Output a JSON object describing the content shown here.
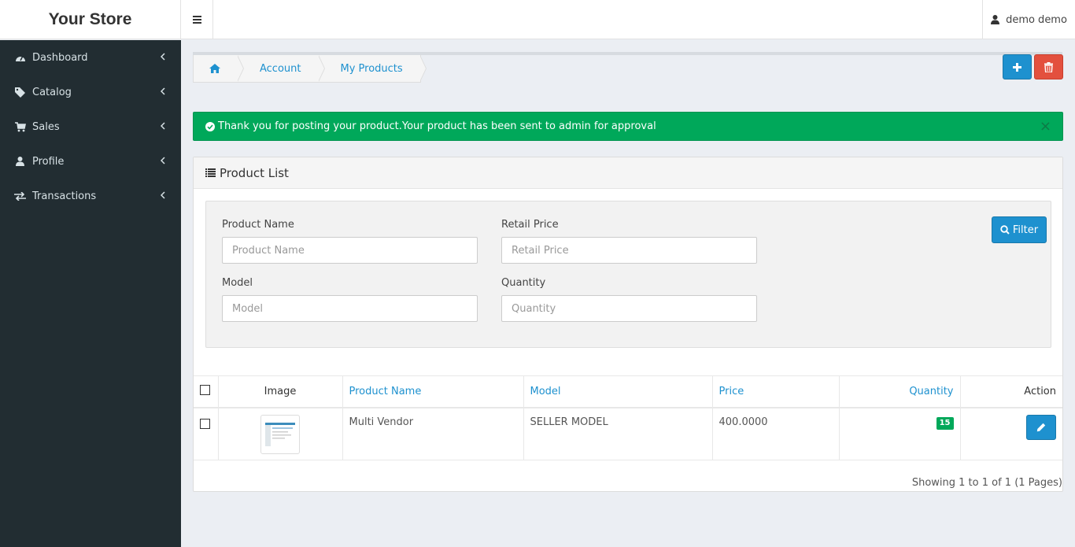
{
  "header": {
    "brand": "Your Store",
    "user": "demo demo"
  },
  "sidebar": {
    "items": [
      {
        "label": "Dashboard",
        "icon": "dashboard-icon"
      },
      {
        "label": "Catalog",
        "icon": "tag-icon"
      },
      {
        "label": "Sales",
        "icon": "cart-icon"
      },
      {
        "label": "Profile",
        "icon": "user-icon"
      },
      {
        "label": "Transactions",
        "icon": "exchange-icon"
      }
    ]
  },
  "breadcrumb": [
    "Account",
    "My Products"
  ],
  "alert": {
    "message": "Thank you for posting your product.Your product has been sent to admin for approval",
    "close": "×"
  },
  "panel": {
    "title": "Product List"
  },
  "filter": {
    "product_name": {
      "label": "Product Name",
      "placeholder": "Product Name"
    },
    "retail_price": {
      "label": "Retail Price",
      "placeholder": "Retail Price"
    },
    "model": {
      "label": "Model",
      "placeholder": "Model"
    },
    "quantity": {
      "label": "Quantity",
      "placeholder": "Quantity"
    },
    "button": "Filter"
  },
  "table": {
    "headers": {
      "image": "Image",
      "name": "Product Name",
      "model": "Model",
      "price": "Price",
      "quantity": "Quantity",
      "action": "Action"
    },
    "rows": [
      {
        "name": "Multi Vendor",
        "model": "SELLER MODEL",
        "price": "400.0000",
        "quantity": "15"
      }
    ]
  },
  "pagination": {
    "showing": "Showing 1 to 1 of 1 (1 Pages)"
  },
  "colors": {
    "primary": "#1e91cf",
    "danger": "#e3503e",
    "success": "#00a85a",
    "sidebar": "#222d32"
  }
}
